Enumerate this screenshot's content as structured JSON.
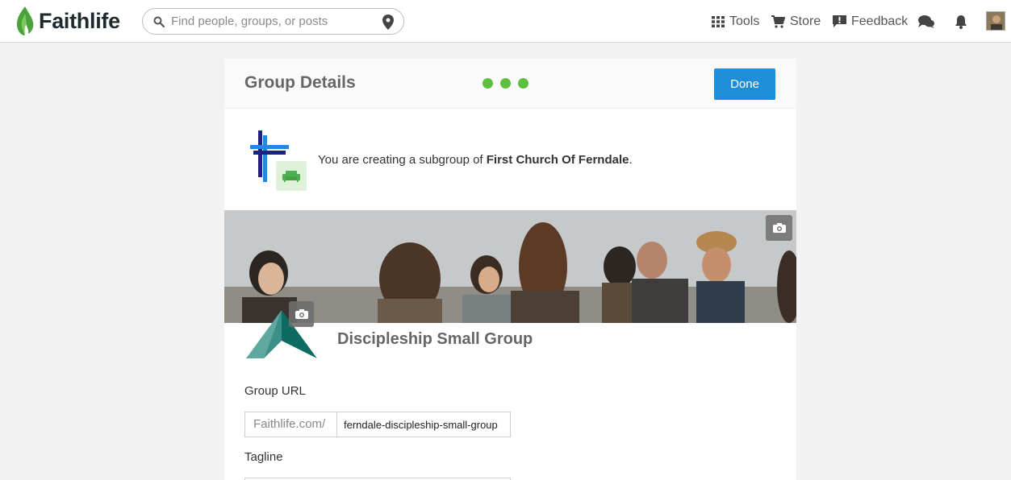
{
  "topbar": {
    "brand": "Faithlife",
    "search_placeholder": "Find people, groups, or posts",
    "nav": {
      "tools": "Tools",
      "store": "Store",
      "feedback": "Feedback"
    }
  },
  "card": {
    "title": "Group Details",
    "done_label": "Done",
    "subgroup_prefix": "You are creating a subgroup of ",
    "parent_group": "First Church Of Ferndale",
    "subgroup_suffix": ".",
    "group_name": "Discipleship Small Group",
    "url_label": "Group URL",
    "url_prefix": "Faithlife.com/",
    "url_value": "ferndale-discipleship-small-group",
    "tagline_label": "Tagline",
    "tagline_value": ""
  },
  "colors": {
    "accent_green": "#5cbf3f",
    "done_blue": "#1e8ed8",
    "brand_green": "#4aa33a"
  }
}
